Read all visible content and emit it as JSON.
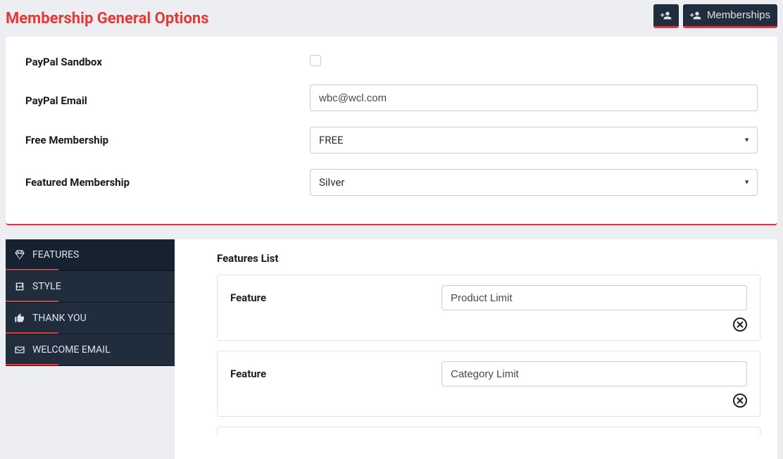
{
  "header": {
    "title": "Membership General Options",
    "buttons": {
      "memberships": "Memberships"
    }
  },
  "form": {
    "sandbox": {
      "label": "PayPal Sandbox",
      "checked": false
    },
    "email": {
      "label": "PayPal Email",
      "value": "wbc@wcl.com"
    },
    "free": {
      "label": "Free Membership",
      "value": "FREE"
    },
    "featured": {
      "label": "Featured Membership",
      "value": "Silver"
    }
  },
  "tabs": [
    {
      "label": "FEATURES",
      "active": true
    },
    {
      "label": "STYLE"
    },
    {
      "label": "THANK YOU"
    },
    {
      "label": "WELCOME EMAIL"
    }
  ],
  "features": {
    "title": "Features List",
    "item_label": "Feature",
    "items": [
      "Product Limit",
      "Category Limit"
    ]
  }
}
